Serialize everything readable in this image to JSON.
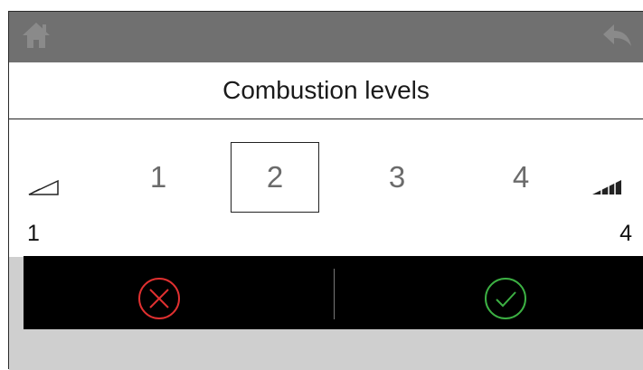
{
  "header": {
    "home_icon": "home-icon",
    "back_icon": "back-arrow-icon"
  },
  "dialog": {
    "title": "Combustion levels",
    "options": [
      "1",
      "2",
      "3",
      "4"
    ],
    "selected_level": "2",
    "range_min": "1",
    "range_max": "4",
    "low_icon": "signal-low-icon",
    "high_icon": "signal-high-icon"
  },
  "actions": {
    "cancel_icon": "cancel-x-icon",
    "confirm_icon": "confirm-check-icon"
  },
  "colors": {
    "cancel": "#e03030",
    "confirm": "#3cb043",
    "topbar": "#707070",
    "actionbar": "#000000"
  }
}
